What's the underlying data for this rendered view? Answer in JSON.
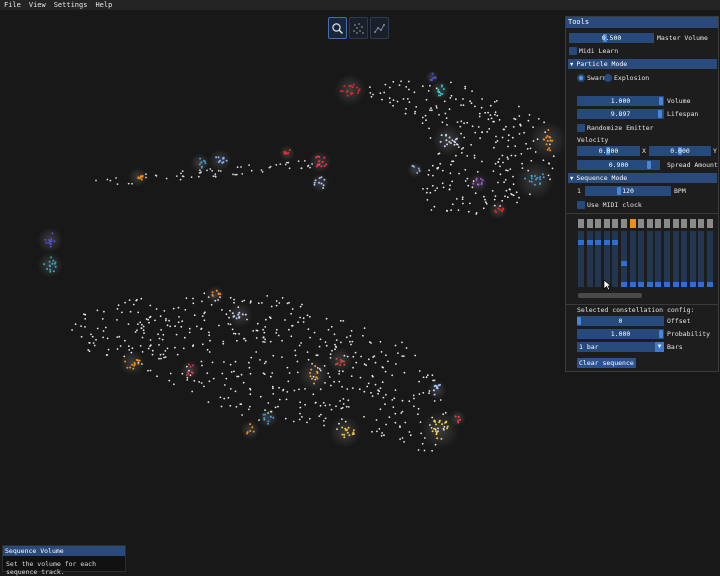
{
  "menu": [
    "File",
    "View",
    "Settings",
    "Help"
  ],
  "viewtools": [
    {
      "icon": "magnifier-icon",
      "active": true
    },
    {
      "icon": "particles-icon",
      "active": false
    },
    {
      "icon": "constellation-icon",
      "active": false
    }
  ],
  "tools": {
    "title": "Tools",
    "master_volume": {
      "value": "0.500",
      "label": "Master Volume",
      "level": 0.42
    },
    "midi_learn": "Midi Learn",
    "particle_mode": {
      "header": "Particle Mode",
      "swarm": "Swarm",
      "explosion": "Explosion",
      "volume": {
        "value": "1.000",
        "label": "Volume",
        "level": 1.0
      },
      "lifespan": {
        "value": "9.897",
        "label": "Lifespan",
        "level": 0.99
      },
      "randomize": "Randomize Emitter",
      "velocity_label": "Velocity",
      "vel_x": {
        "value": "0.000",
        "label": "X",
        "level": 0.5
      },
      "vel_y": {
        "value": "0.000",
        "label": "Y",
        "level": 0.5
      },
      "spread": {
        "value": "0.900",
        "label": "Spread Amount",
        "level": 0.9
      }
    },
    "sequence_mode": {
      "header": "Sequence Mode",
      "bpm_step": "1",
      "bpm_value": "120",
      "bpm_label": "BPM",
      "bpm_level": 0.4,
      "midi_clock": "Use MIDI clock"
    },
    "sequencer": {
      "active_step": 6,
      "columns": [
        {
          "cells": [
            12
          ]
        },
        {
          "cells": [
            12
          ]
        },
        {
          "cells": [
            12
          ]
        },
        {
          "cells": [
            12
          ]
        },
        {
          "cells": [
            12
          ]
        },
        {
          "cells": [
            0,
            6
          ]
        },
        {
          "cells": [
            0
          ]
        },
        {
          "cells": [
            0
          ]
        },
        {
          "cells": [
            0
          ]
        },
        {
          "cells": [
            0
          ]
        },
        {
          "cells": [
            0
          ]
        },
        {
          "cells": [
            0
          ]
        },
        {
          "cells": [
            0
          ]
        },
        {
          "cells": [
            0
          ]
        },
        {
          "cells": [
            0
          ]
        },
        {
          "cells": [
            0
          ]
        }
      ],
      "rows": 16
    },
    "constellation": {
      "label": "Selected constellation config:",
      "offset": {
        "value": "0",
        "label": "Offset",
        "level": 0.0
      },
      "probability": {
        "value": "1.000",
        "label": "Probability",
        "level": 1.0
      },
      "bars": {
        "value": "1 bar",
        "label": "Bars"
      },
      "clear_button": "Clear sequence"
    }
  },
  "tooltip": {
    "title": "Sequence Volume",
    "text": "Set the volume for each sequence track."
  },
  "colors": {
    "accent": "#294a7a",
    "field": "#264a7c",
    "grab": "#4a86d8",
    "active_step": "#f08c1c"
  }
}
